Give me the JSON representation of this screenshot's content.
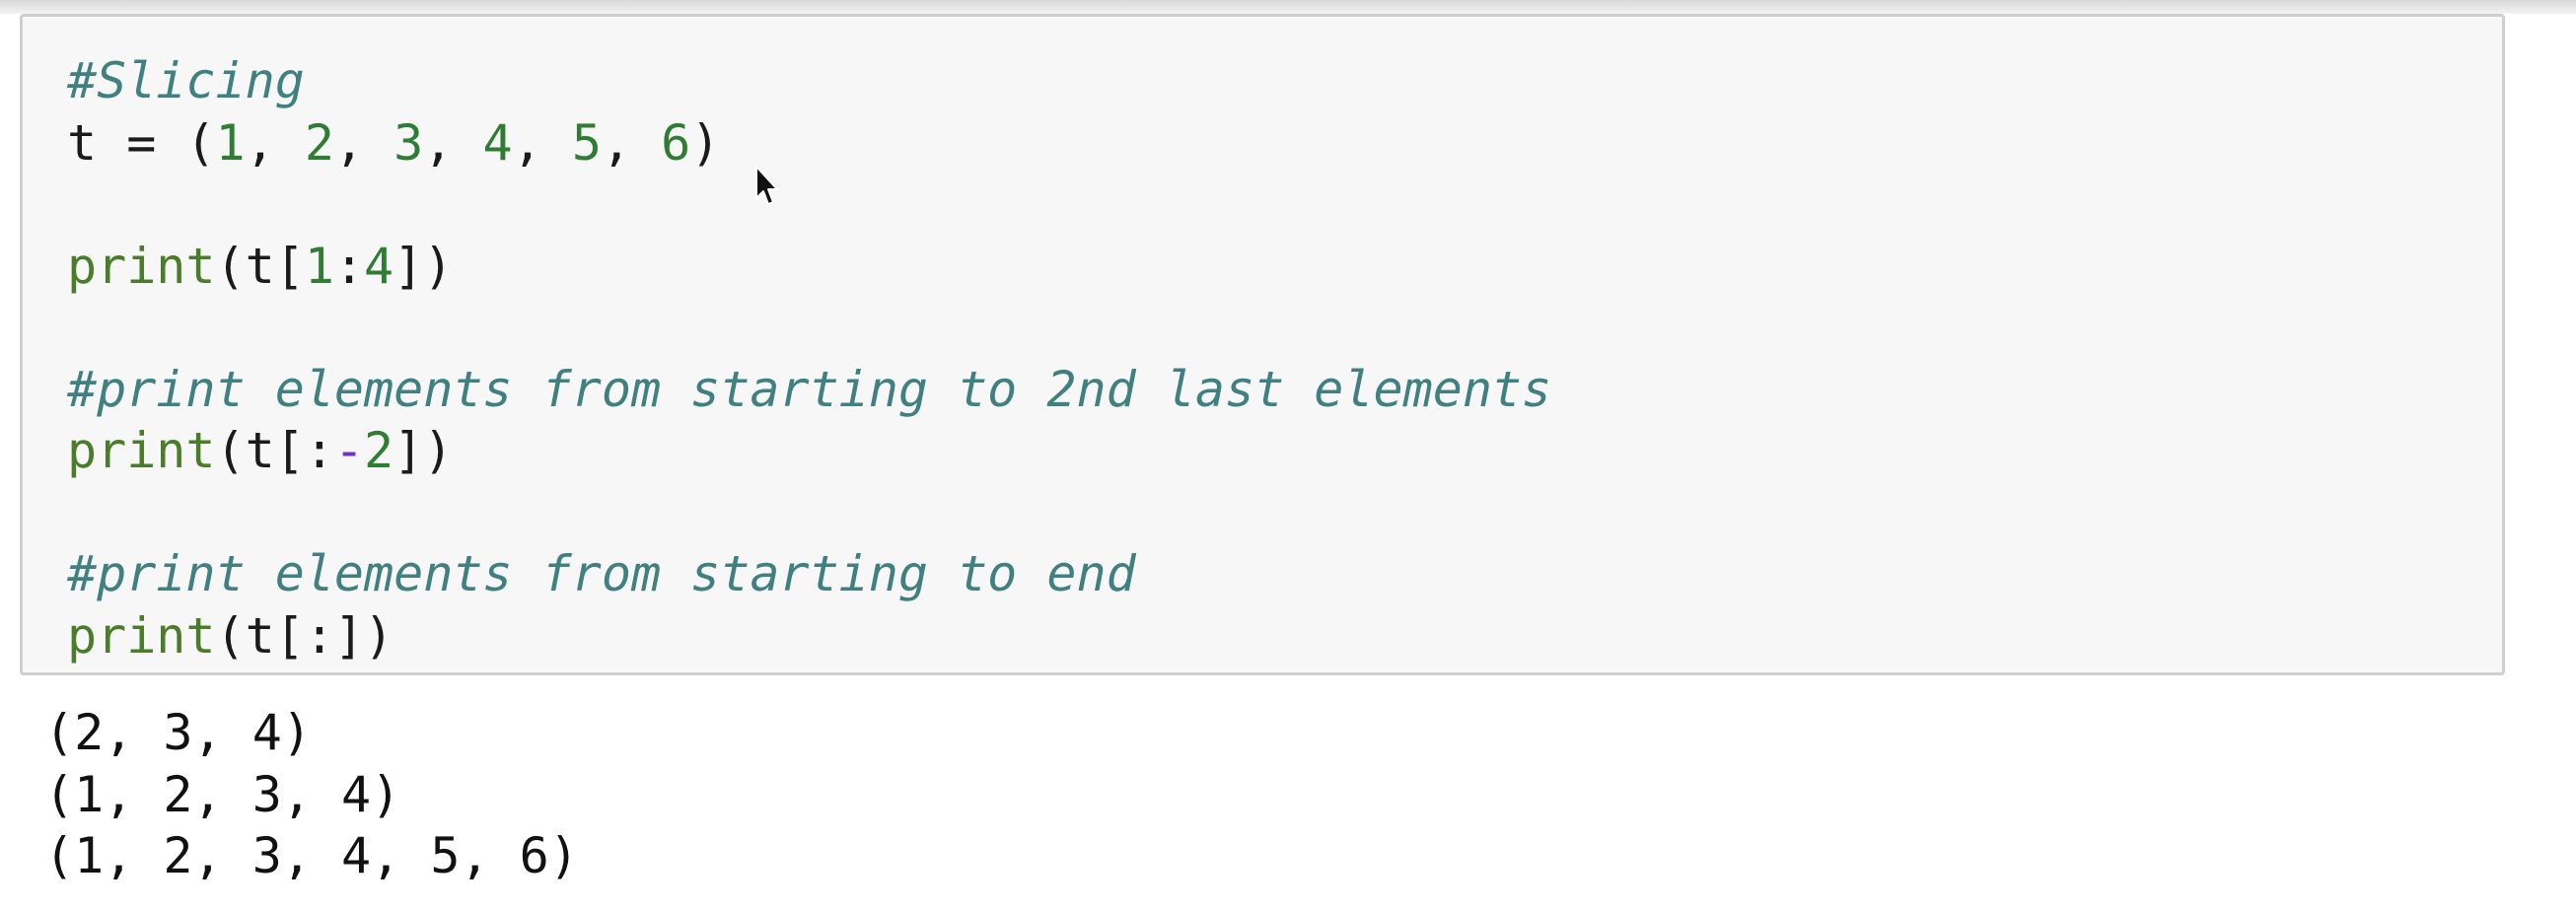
{
  "cell": {
    "code_lines": [
      [
        {
          "t": "#Slicing",
          "c": "cmt"
        }
      ],
      [
        {
          "t": "t = (",
          "c": ""
        },
        {
          "t": "1",
          "c": "num"
        },
        {
          "t": ", ",
          "c": ""
        },
        {
          "t": "2",
          "c": "num"
        },
        {
          "t": ", ",
          "c": ""
        },
        {
          "t": "3",
          "c": "num"
        },
        {
          "t": ", ",
          "c": ""
        },
        {
          "t": "4",
          "c": "num"
        },
        {
          "t": ", ",
          "c": ""
        },
        {
          "t": "5",
          "c": "num"
        },
        {
          "t": ", ",
          "c": ""
        },
        {
          "t": "6",
          "c": "num"
        },
        {
          "t": ")",
          "c": ""
        }
      ],
      [],
      [
        {
          "t": "print",
          "c": "kw"
        },
        {
          "t": "(t[",
          "c": ""
        },
        {
          "t": "1",
          "c": "num"
        },
        {
          "t": ":",
          "c": ""
        },
        {
          "t": "4",
          "c": "num"
        },
        {
          "t": "])",
          "c": ""
        }
      ],
      [],
      [
        {
          "t": "#print elements from starting to 2nd last elements",
          "c": "cmt"
        }
      ],
      [
        {
          "t": "print",
          "c": "kw"
        },
        {
          "t": "(t[:",
          "c": ""
        },
        {
          "t": "-",
          "c": "op"
        },
        {
          "t": "2",
          "c": "num"
        },
        {
          "t": "])",
          "c": ""
        }
      ],
      [],
      [
        {
          "t": "#print elements from starting to end",
          "c": "cmt"
        }
      ],
      [
        {
          "t": "print",
          "c": "kw"
        },
        {
          "t": "(t[:])",
          "c": ""
        }
      ]
    ],
    "output_lines": [
      "(2, 3, 4)",
      "(1, 2, 3, 4)",
      "(1, 2, 3, 4, 5, 6)"
    ]
  }
}
